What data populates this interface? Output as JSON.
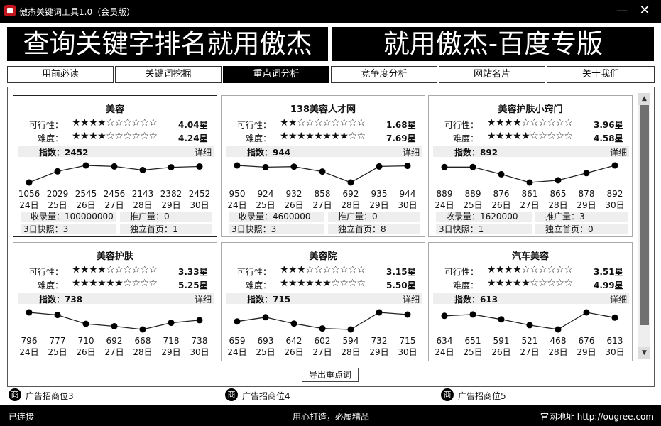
{
  "window": {
    "title": "傲杰关键词工具1.0（会员版）",
    "min_label": "—",
    "close_label": "✕",
    "icon": "app-logo-icon"
  },
  "banner": {
    "left": "查询关键字排名就用傲杰",
    "right": "就用傲杰-百度专版"
  },
  "tabs": [
    {
      "label": "用前必读",
      "active": false
    },
    {
      "label": "关键词挖掘",
      "active": false
    },
    {
      "label": "重点词分析",
      "active": true
    },
    {
      "label": "竞争度分析",
      "active": false
    },
    {
      "label": "网站名片",
      "active": false
    },
    {
      "label": "关于我们",
      "active": false
    }
  ],
  "labels": {
    "feasibility": "可行性：",
    "difficulty": "难度：",
    "index": "指数：",
    "detail": "详细",
    "indexed": "收录量：",
    "promotion": "推广量：",
    "snapshot": "3日快照：",
    "homepage": "独立首页："
  },
  "days": [
    "24日",
    "25日",
    "26日",
    "27日",
    "28日",
    "29日",
    "30日"
  ],
  "cards": [
    {
      "title": "美容",
      "selected": true,
      "feasibility": 4.04,
      "feasibility_text": "4.04星",
      "difficulty": 4.24,
      "difficulty_text": "4.24星",
      "index": "2452",
      "trend": [
        1056,
        2029,
        2545,
        2456,
        2143,
        2382,
        2452
      ],
      "trend_text": [
        "1056",
        "2029",
        "2545",
        "2456",
        "2143",
        "2382",
        "2452"
      ],
      "indexed": "100000000",
      "promotion": "0",
      "snapshot": "3",
      "homepage": "1"
    },
    {
      "title": "138美容人才网",
      "selected": false,
      "feasibility": 1.68,
      "feasibility_text": "1.68星",
      "difficulty": 7.69,
      "difficulty_text": "7.69星",
      "index": "944",
      "trend": [
        950,
        924,
        932,
        858,
        692,
        935,
        944
      ],
      "trend_text": [
        "950",
        "924",
        "932",
        "858",
        "692",
        "935",
        "944"
      ],
      "indexed": "4600000",
      "promotion": "0",
      "snapshot": "3",
      "homepage": "8"
    },
    {
      "title": "美容护肤小窍门",
      "selected": false,
      "feasibility": 3.96,
      "feasibility_text": "3.96星",
      "difficulty": 4.58,
      "difficulty_text": "4.58星",
      "index": "892",
      "trend": [
        889,
        889,
        876,
        861,
        865,
        878,
        892
      ],
      "trend_text": [
        "889",
        "889",
        "876",
        "861",
        "865",
        "878",
        "892"
      ],
      "indexed": "1620000",
      "promotion": "3",
      "snapshot": "1",
      "homepage": "0"
    },
    {
      "title": "美容护肤",
      "selected": false,
      "feasibility": 3.33,
      "feasibility_text": "3.33星",
      "difficulty": 5.25,
      "difficulty_text": "5.25星",
      "index": "738",
      "trend": [
        796,
        777,
        710,
        692,
        668,
        718,
        738
      ],
      "trend_text": [
        "796",
        "777",
        "710",
        "692",
        "668",
        "718",
        "738"
      ]
    },
    {
      "title": "美容院",
      "selected": false,
      "feasibility": 3.15,
      "feasibility_text": "3.15星",
      "difficulty": 5.5,
      "difficulty_text": "5.50星",
      "index": "715",
      "trend": [
        659,
        693,
        642,
        602,
        594,
        732,
        715
      ],
      "trend_text": [
        "659",
        "693",
        "642",
        "602",
        "594",
        "732",
        "715"
      ]
    },
    {
      "title": "汽车美容",
      "selected": false,
      "feasibility": 3.51,
      "feasibility_text": "3.51星",
      "difficulty": 4.99,
      "difficulty_text": "4.99星",
      "index": "613",
      "trend": [
        634,
        651,
        591,
        521,
        468,
        676,
        613
      ],
      "trend_text": [
        "634",
        "651",
        "591",
        "521",
        "468",
        "676",
        "613"
      ]
    }
  ],
  "stars_max": 10,
  "export_label": "导出重点词",
  "ads": [
    {
      "icon_char": "商",
      "label": "广告招商位3"
    },
    {
      "icon_char": "商",
      "label": "广告招商位4"
    },
    {
      "icon_char": "商",
      "label": "广告招商位5"
    }
  ],
  "status": {
    "left": "已连接",
    "center": "用心打造，必属精品",
    "right": "官网地址  http://ougree.com"
  }
}
